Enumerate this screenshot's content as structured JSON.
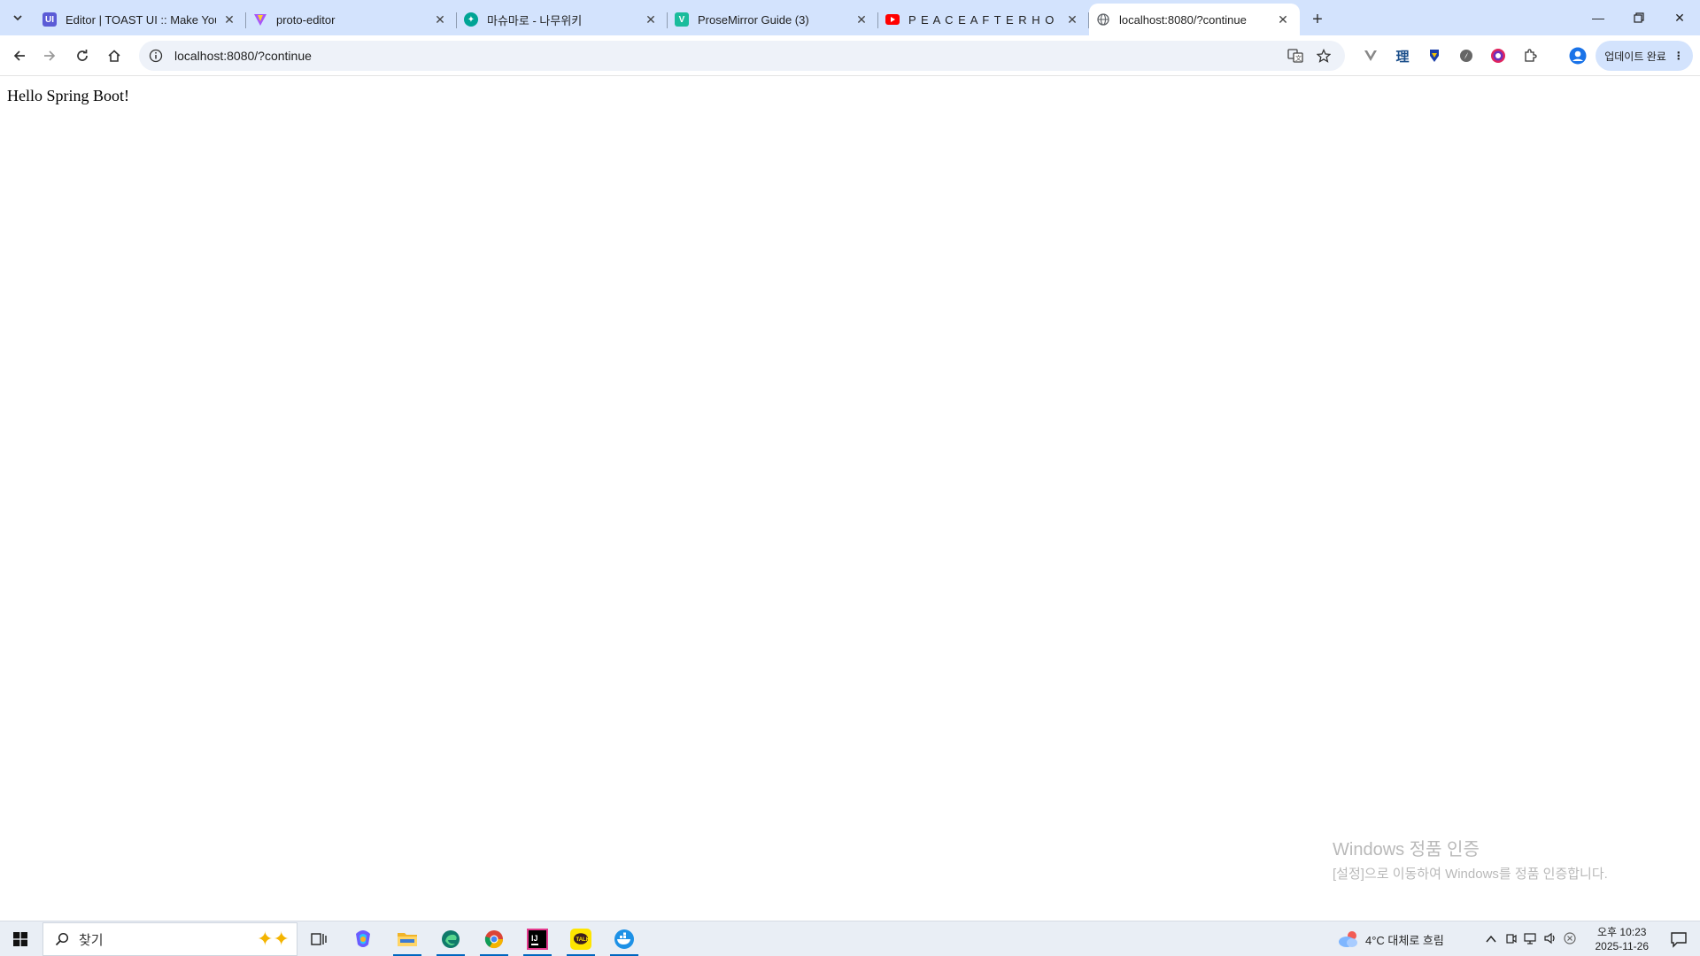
{
  "tabs": [
    {
      "title": "Editor | TOAST UI :: Make Your Web Delightful",
      "favicon": "toast-ui-icon",
      "color": "#5b5bd6"
    },
    {
      "title": "proto-editor",
      "favicon": "vite-icon",
      "color": "#a855f7"
    },
    {
      "title": "마슈마로 - 나무위키",
      "favicon": "namuwiki-icon",
      "color": "#00a495"
    },
    {
      "title": "ProseMirror Guide (3)",
      "favicon": "vue-icon",
      "color": "#1abc9c"
    },
    {
      "title": "P E A C E   A F T E R   H O",
      "favicon": "youtube-icon",
      "color": "#ff0000"
    },
    {
      "title": "localhost:8080/?continue",
      "favicon": "globe-icon",
      "color": "#5f6368"
    }
  ],
  "address_bar": {
    "url": "localhost:8080/?continue"
  },
  "update_button": {
    "label": "업데이트 완료"
  },
  "page": {
    "text": "Hello Spring Boot!"
  },
  "watermark": {
    "title": "Windows 정품 인증",
    "subtitle": "[설정]으로 이동하여 Windows를 정품 인증합니다."
  },
  "taskbar": {
    "search_placeholder": "찾기",
    "weather": "4°C  대체로 흐림",
    "time": "오후 10:23",
    "date": "2025-11-26"
  }
}
